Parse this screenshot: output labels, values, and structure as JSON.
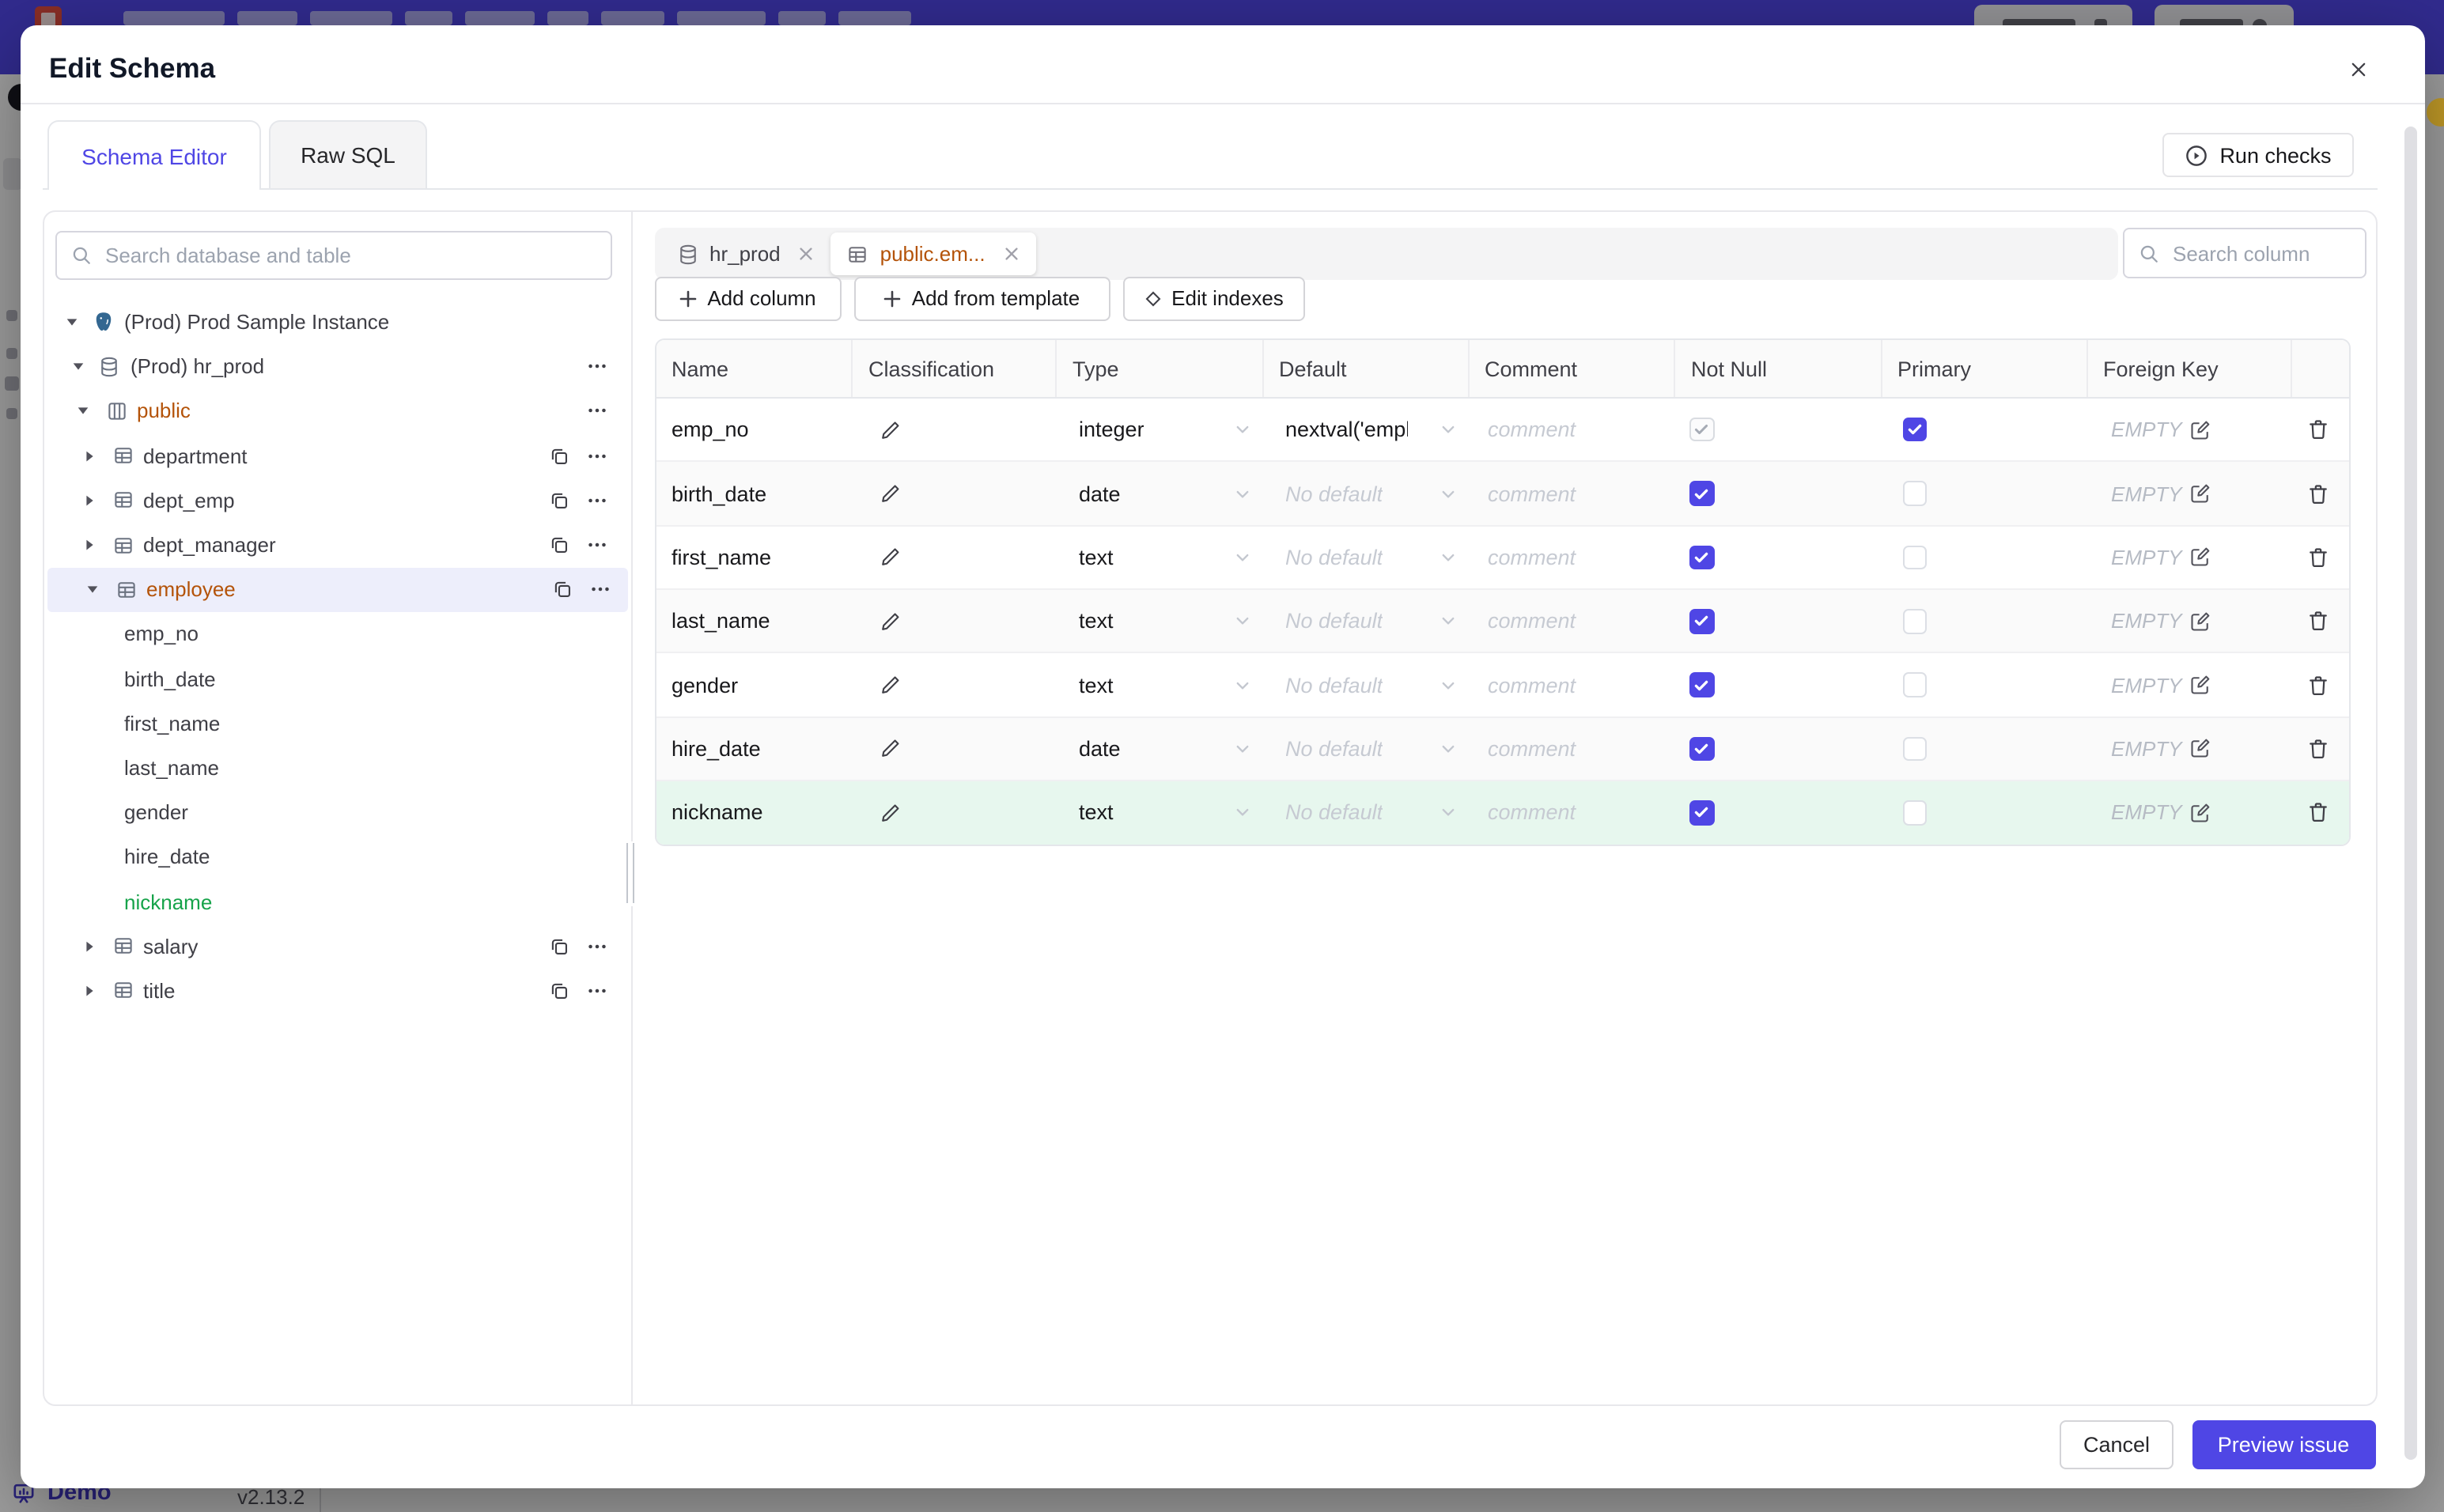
{
  "colors": {
    "accent": "#4f46e5",
    "topbar": "#4f46e5",
    "modified_amber": "#b45309",
    "created_green": "#16a34a",
    "created_row_bg": "#e7f7ee",
    "selected_row_bg": "#edeefb"
  },
  "background": {
    "demo_label": "Demo",
    "version": "v2.13.2"
  },
  "dialog": {
    "title": "Edit Schema",
    "tabs": [
      {
        "label": "Schema Editor",
        "active": true
      },
      {
        "label": "Raw SQL",
        "active": false
      }
    ],
    "run_checks_label": "Run checks",
    "sidebar": {
      "search_placeholder": "Search database and table",
      "tree": [
        {
          "label": "(Prod) Prod Sample Instance",
          "level": 0,
          "icon": "postgres",
          "arrow": "down"
        },
        {
          "label": "(Prod) hr_prod",
          "level": 1,
          "icon": "database",
          "arrow": "down",
          "menu": true
        },
        {
          "label": "public",
          "level": 2,
          "icon": "schema",
          "arrow": "down",
          "menu": true,
          "state": "modified"
        },
        {
          "label": "department",
          "level": 3,
          "icon": "table",
          "arrow": "right",
          "copy": true,
          "menu": true
        },
        {
          "label": "dept_emp",
          "level": 3,
          "icon": "table",
          "arrow": "right",
          "copy": true,
          "menu": true
        },
        {
          "label": "dept_manager",
          "level": 3,
          "icon": "table",
          "arrow": "right",
          "copy": true,
          "menu": true
        },
        {
          "label": "employee",
          "level": 3,
          "icon": "table",
          "arrow": "down",
          "copy": true,
          "menu": true,
          "state": "modified",
          "selected": true
        },
        {
          "label": "emp_no",
          "level": 4
        },
        {
          "label": "birth_date",
          "level": 4
        },
        {
          "label": "first_name",
          "level": 4
        },
        {
          "label": "last_name",
          "level": 4
        },
        {
          "label": "gender",
          "level": 4
        },
        {
          "label": "hire_date",
          "level": 4
        },
        {
          "label": "nickname",
          "level": 4,
          "state": "created"
        },
        {
          "label": "salary",
          "level": 3,
          "icon": "table",
          "arrow": "right",
          "copy": true,
          "menu": true
        },
        {
          "label": "title",
          "level": 3,
          "icon": "table",
          "arrow": "right",
          "copy": true,
          "menu": true
        }
      ]
    },
    "editor": {
      "open_tabs": [
        {
          "label": "hr_prod",
          "icon": "database",
          "active": false
        },
        {
          "label": "public.em...",
          "icon": "table",
          "active": true,
          "state": "modified"
        }
      ],
      "column_search_placeholder": "Search column",
      "actions": [
        {
          "label": "Add column",
          "icon": "plus"
        },
        {
          "label": "Add from template",
          "icon": "plus"
        },
        {
          "label": "Edit indexes",
          "icon": "diamond"
        }
      ],
      "table": {
        "columns": [
          "Name",
          "Classification",
          "Type",
          "Default",
          "Comment",
          "Not Null",
          "Primary",
          "Foreign Key",
          ""
        ],
        "comment_placeholder": "comment",
        "fk_value": "EMPTY",
        "rows": [
          {
            "name": "emp_no",
            "type": "integer",
            "default": "nextval('employ",
            "default_is_placeholder": false,
            "not_null": "checked-disabled",
            "primary": "checked"
          },
          {
            "name": "birth_date",
            "type": "date",
            "default": "No default",
            "default_is_placeholder": true,
            "not_null": "checked",
            "primary": "unchecked"
          },
          {
            "name": "first_name",
            "type": "text",
            "default": "No default",
            "default_is_placeholder": true,
            "not_null": "checked",
            "primary": "unchecked"
          },
          {
            "name": "last_name",
            "type": "text",
            "default": "No default",
            "default_is_placeholder": true,
            "not_null": "checked",
            "primary": "unchecked"
          },
          {
            "name": "gender",
            "type": "text",
            "default": "No default",
            "default_is_placeholder": true,
            "not_null": "checked",
            "primary": "unchecked"
          },
          {
            "name": "hire_date",
            "type": "date",
            "default": "No default",
            "default_is_placeholder": true,
            "not_null": "checked",
            "primary": "unchecked"
          },
          {
            "name": "nickname",
            "type": "text",
            "default": "No default",
            "default_is_placeholder": true,
            "not_null": "checked",
            "primary": "unchecked",
            "state": "created"
          }
        ]
      }
    },
    "footer": {
      "cancel_label": "Cancel",
      "primary_label": "Preview issue"
    }
  }
}
